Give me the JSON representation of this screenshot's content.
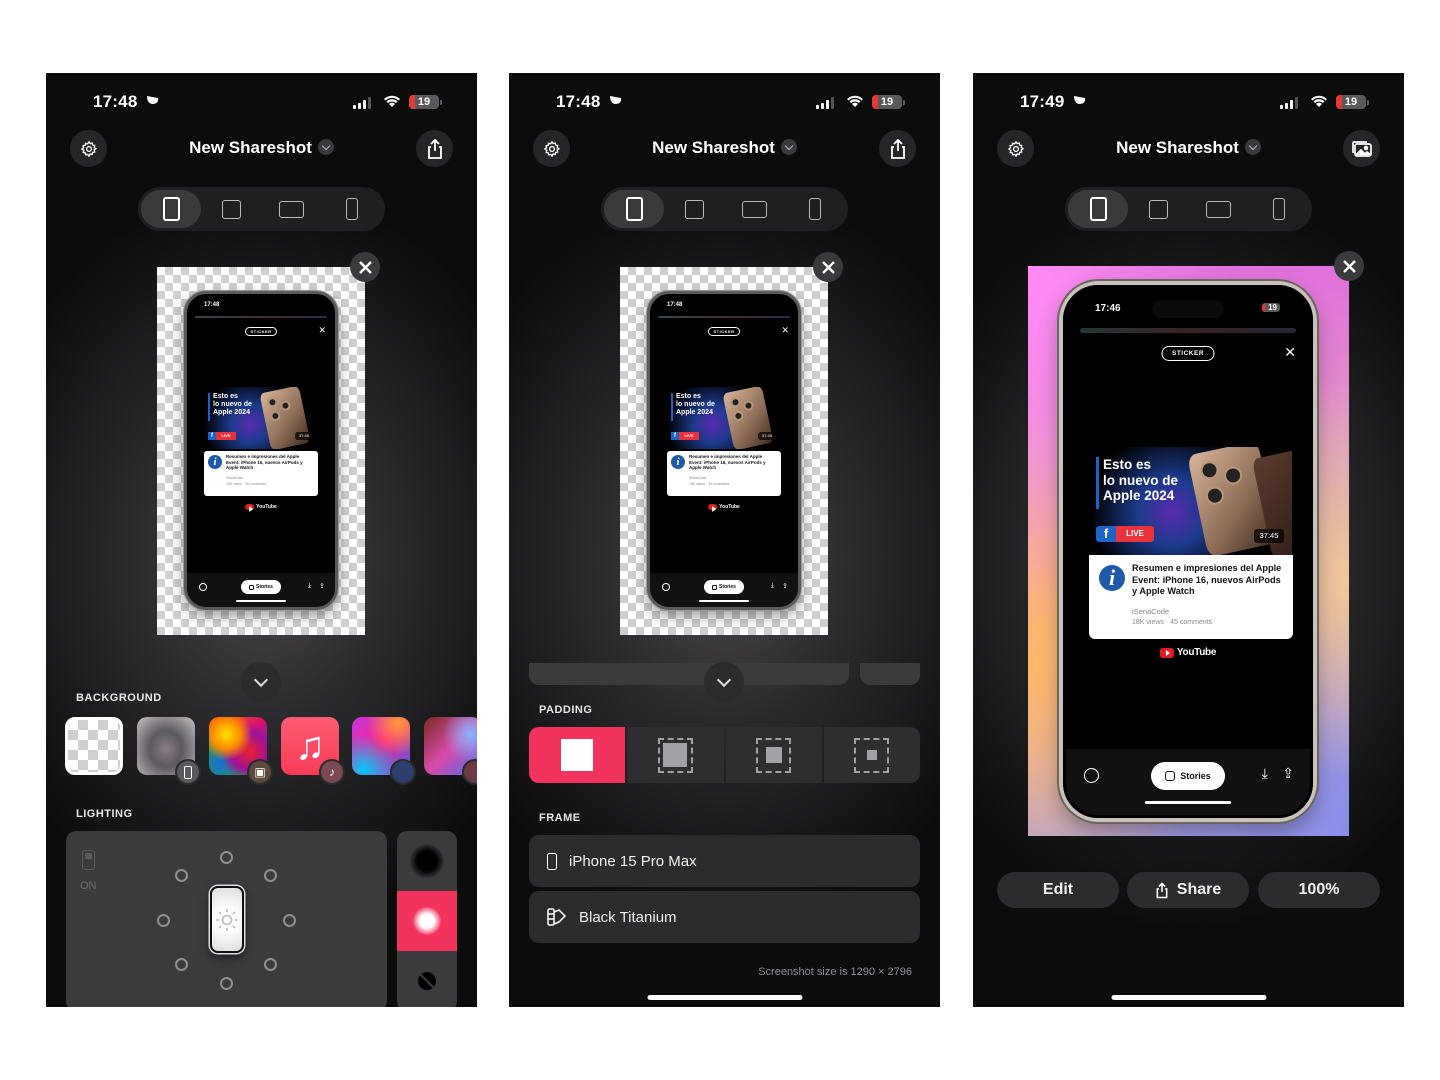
{
  "screens": [
    {
      "status": {
        "time": "17:48",
        "battery": "19"
      },
      "header": {
        "title": "New Shareshot",
        "left_icon": "gear-icon",
        "right_icon": "share-icon"
      },
      "aspect_options": [
        "portrait",
        "square",
        "landscape",
        "device"
      ],
      "aspect_selected": "portrait",
      "preview": {
        "background": "transparent-checkerboard",
        "phone_status_time": "17:48",
        "sticker_label": "STICKER",
        "banner_text": [
          "Esto es",
          "lo nuevo de",
          "Apple 2024"
        ],
        "live_label": "LIVE",
        "duration": "37:45",
        "card_title": "Resumen e impresiones del Apple Event: iPhone 16, nuevos AirPods y Apple Watch",
        "card_channel": "iSenaCode",
        "card_meta": "18K views · 45 comments",
        "youtube_label": "YouTube",
        "stories_label": "Stories"
      },
      "background_section": {
        "label": "BACKGROUND",
        "items": [
          {
            "name": "transparent",
            "badge": null,
            "selected": true
          },
          {
            "name": "blurred-screenshot",
            "badge": "phone-icon"
          },
          {
            "name": "photo",
            "badge": "image-icon"
          },
          {
            "name": "music",
            "badge": "music-icon"
          },
          {
            "name": "apple-gradient-1",
            "badge": "apple-icon"
          },
          {
            "name": "apple-gradient-2",
            "badge": "apple-icon"
          }
        ]
      },
      "lighting_section": {
        "label": "LIGHTING",
        "toggle_label": "ON",
        "side_options": [
          "shadow",
          "glow",
          "none"
        ],
        "side_selected": "glow"
      }
    },
    {
      "status": {
        "time": "17:48",
        "battery": "19"
      },
      "header": {
        "title": "New Shareshot",
        "left_icon": "gear-icon",
        "right_icon": "share-icon"
      },
      "aspect_options": [
        "portrait",
        "square",
        "landscape",
        "device"
      ],
      "aspect_selected": "portrait",
      "preview": {
        "background": "transparent-checkerboard",
        "phone_status_time": "17:48",
        "sticker_label": "STICKER",
        "banner_text": [
          "Esto es",
          "lo nuevo de",
          "Apple 2024"
        ],
        "live_label": "LIVE",
        "duration": "37:45",
        "card_title": "Resumen e impresiones del Apple Event: iPhone 16, nuevos AirPods y Apple Watch",
        "card_channel": "iSenaCode",
        "card_meta": "18K views · 45 comments",
        "youtube_label": "YouTube",
        "stories_label": "Stories"
      },
      "padding_section": {
        "label": "PADDING",
        "options": [
          "none",
          "small",
          "medium",
          "large"
        ],
        "selected": "none"
      },
      "frame_section": {
        "label": "FRAME",
        "device": "iPhone 15 Pro Max",
        "color": "Black Titanium"
      },
      "size_note": "Screenshot size is 1290 × 2796"
    },
    {
      "status": {
        "time": "17:49",
        "battery": "19"
      },
      "header": {
        "title": "New Shareshot",
        "left_icon": "gear-icon",
        "right_icon": "photos-icon"
      },
      "aspect_options": [
        "portrait",
        "square",
        "landscape",
        "device"
      ],
      "aspect_selected": "portrait",
      "preview": {
        "background": "pink-orange-violet-gradient",
        "phone_status_time": "17:46",
        "sticker_label": "STICKER",
        "banner_text": [
          "Esto es",
          "lo nuevo de",
          "Apple 2024"
        ],
        "live_label": "LIVE",
        "duration": "37:45",
        "card_title": "Resumen e impresiones del Apple Event: iPhone 16, nuevos AirPods y Apple Watch",
        "card_channel": "iSenaCode",
        "card_meta": "18K views · 45 comments",
        "youtube_label": "YouTube",
        "stories_label": "Stories"
      },
      "actions": {
        "edit": "Edit",
        "share": "Share",
        "zoom": "100%"
      }
    }
  ],
  "colors": {
    "accent": "#f2335e",
    "panel": "#2c2c2e",
    "background": "#0c0c0d"
  }
}
